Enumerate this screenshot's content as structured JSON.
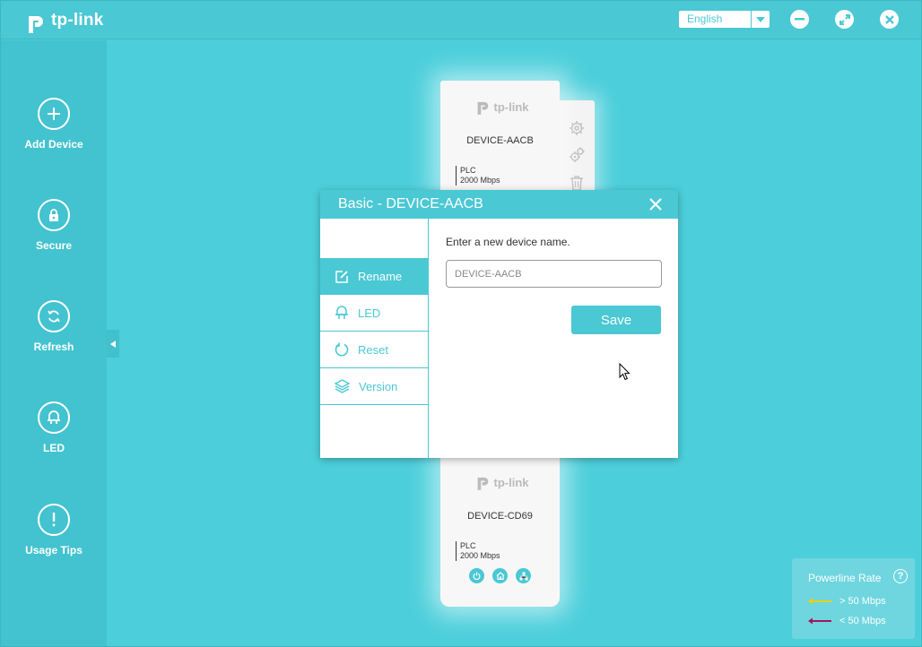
{
  "app": {
    "brand": "tp-link"
  },
  "header": {
    "language": "English",
    "buttons": [
      {
        "name": "minimize",
        "icon": "minus-icon"
      },
      {
        "name": "restore",
        "icon": "arrows-icon"
      },
      {
        "name": "close",
        "icon": "close-icon"
      }
    ]
  },
  "sidebar": {
    "items": [
      {
        "label": "Add Device",
        "icon": "plus-icon"
      },
      {
        "label": "Secure",
        "icon": "lock-icon"
      },
      {
        "label": "Refresh",
        "icon": "refresh-icon"
      },
      {
        "label": "LED",
        "icon": "led-bulb-icon"
      },
      {
        "label": "Usage Tips",
        "icon": "exclamation-icon"
      }
    ]
  },
  "devices": [
    {
      "brand": "tp-link",
      "name": "DEVICE-AACB",
      "spec_type": "PLC",
      "spec_rate": "2000 Mbps"
    },
    {
      "brand": "tp-link",
      "name": "DEVICE-CD69",
      "spec_type": "PLC",
      "spec_rate": "2000 Mbps"
    }
  ],
  "device_tools": [
    "gear-icon",
    "gears-icon",
    "trash-icon"
  ],
  "device_status_icons": [
    "power-icon",
    "home-icon",
    "network-icon"
  ],
  "dialog": {
    "title": "Basic - DEVICE-AACB",
    "nav": [
      {
        "label": "Rename",
        "icon": "edit-icon",
        "active": true
      },
      {
        "label": "LED",
        "icon": "led-bulb-icon",
        "active": false
      },
      {
        "label": "Reset",
        "icon": "reset-icon",
        "active": false
      },
      {
        "label": "Version",
        "icon": "layers-icon",
        "active": false
      }
    ],
    "prompt": "Enter a new device name.",
    "input_placeholder": "DEVICE-AACB",
    "save_label": "Save"
  },
  "legend": {
    "title": "Powerline Rate",
    "help": "?",
    "rows": [
      {
        "label": "> 50 Mbps",
        "color": "#e8d400"
      },
      {
        "label": "< 50 Mbps",
        "color": "#a0175a"
      }
    ]
  },
  "colors": {
    "accent": "#4ac8d4",
    "background": "#4ccfdb"
  }
}
